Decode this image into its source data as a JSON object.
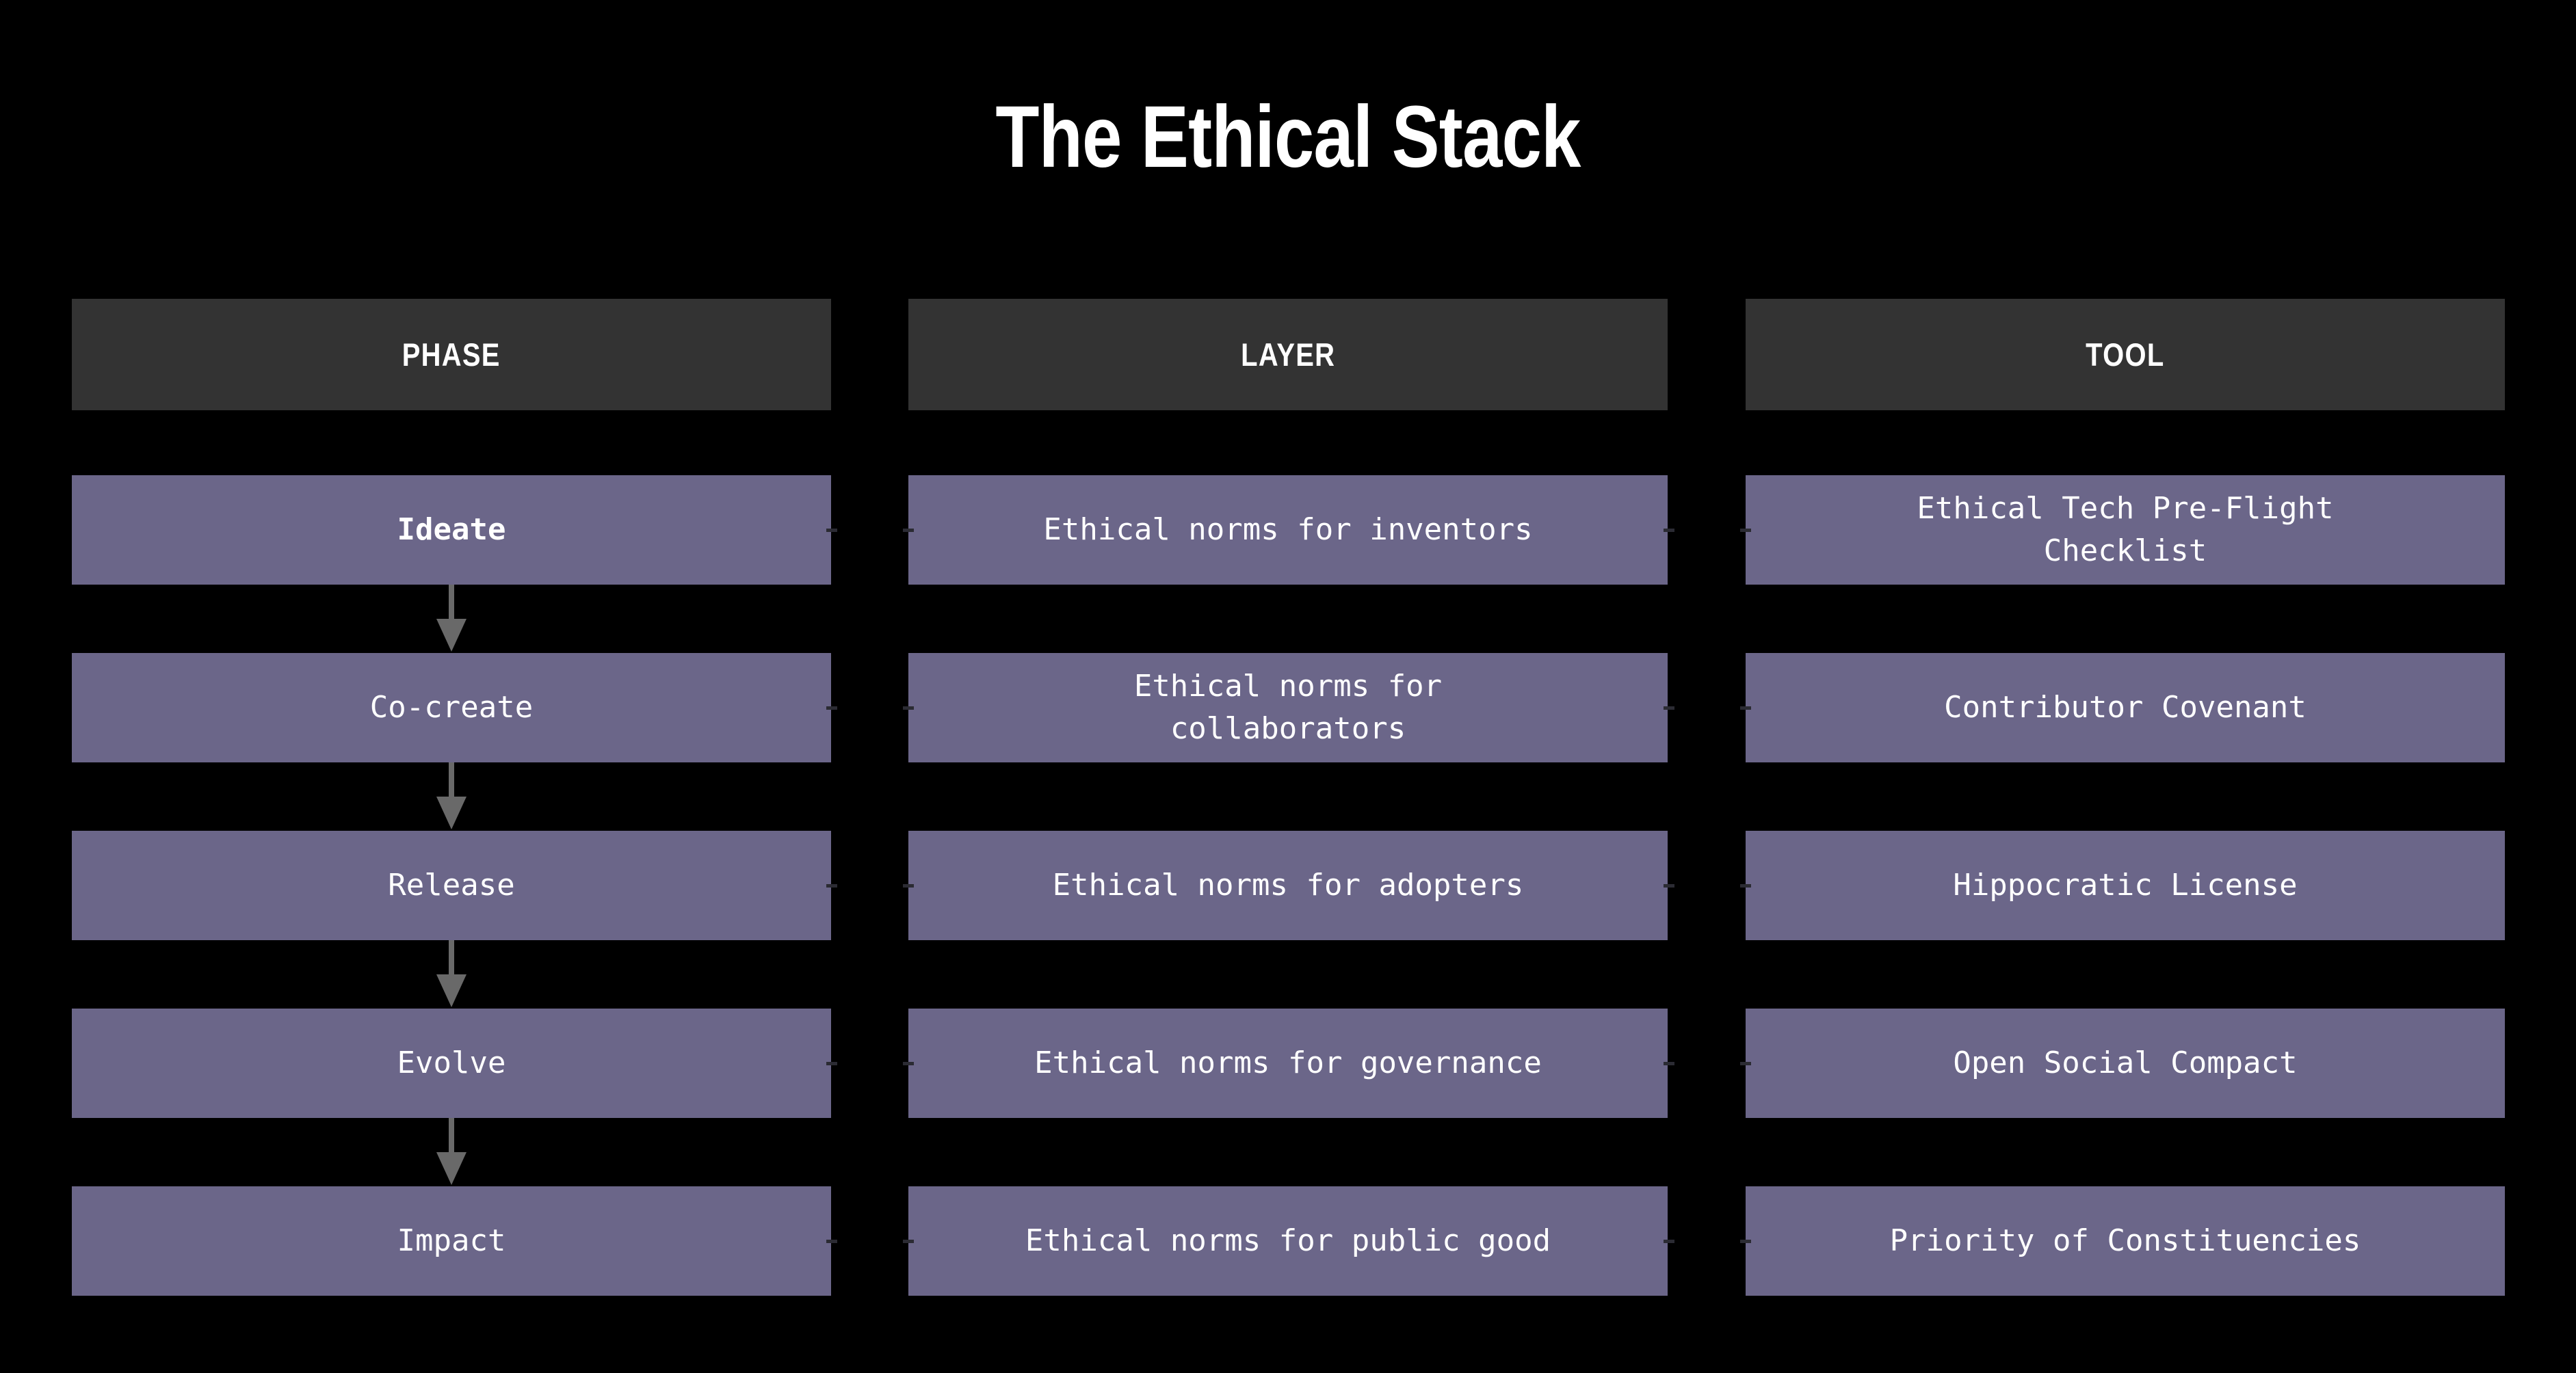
{
  "title": "The Ethical Stack",
  "colors": {
    "background": "#000000",
    "header_bar": "#333333",
    "cell": "#6b6689",
    "arrow": "#696969",
    "text": "#ffffff"
  },
  "columns": [
    {
      "key": "phase",
      "header": "PHASE",
      "cells": [
        {
          "label": "Ideate",
          "emphasis": "bold"
        },
        {
          "label": "Co-create",
          "emphasis": "normal"
        },
        {
          "label": "Release",
          "emphasis": "normal"
        },
        {
          "label": "Evolve",
          "emphasis": "normal"
        },
        {
          "label": "Impact",
          "emphasis": "normal"
        }
      ]
    },
    {
      "key": "layer",
      "header": "LAYER",
      "cells": [
        {
          "label": "Ethical norms for inventors",
          "emphasis": "normal"
        },
        {
          "label": "Ethical norms for\ncollaborators",
          "emphasis": "normal"
        },
        {
          "label": "Ethical norms for adopters",
          "emphasis": "normal"
        },
        {
          "label": "Ethical norms for governance",
          "emphasis": "normal"
        },
        {
          "label": "Ethical norms for public good",
          "emphasis": "normal"
        }
      ]
    },
    {
      "key": "tool",
      "header": "TOOL",
      "cells": [
        {
          "label": "Ethical Tech Pre-Flight\nChecklist",
          "emphasis": "normal"
        },
        {
          "label": "Contributor Covenant",
          "emphasis": "normal"
        },
        {
          "label": "Hippocratic License",
          "emphasis": "normal"
        },
        {
          "label": "Open Social Compact",
          "emphasis": "normal"
        },
        {
          "label": "Priority of Constituencies",
          "emphasis": "normal"
        }
      ]
    }
  ],
  "flow_arrows": [
    {
      "from": "Ideate",
      "to": "Co-create"
    },
    {
      "from": "Co-create",
      "to": "Release"
    },
    {
      "from": "Release",
      "to": "Evolve"
    },
    {
      "from": "Evolve",
      "to": "Impact"
    }
  ]
}
